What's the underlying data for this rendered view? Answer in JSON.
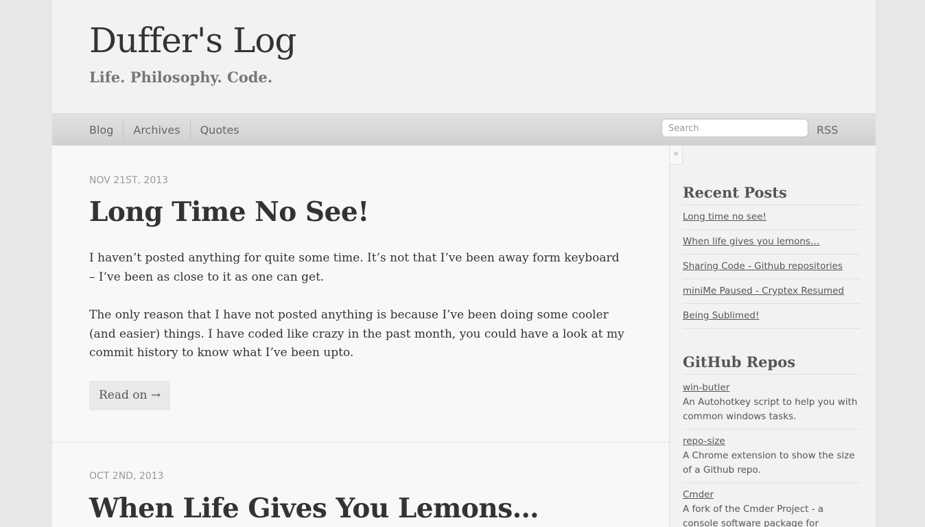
{
  "site": {
    "title": "Duffer's Log",
    "tagline": "Life. Philosophy. Code."
  },
  "nav": {
    "items": [
      "Blog",
      "Archives",
      "Quotes"
    ],
    "search_placeholder": "Search",
    "rss_label": "RSS"
  },
  "sidebar": {
    "toggle_glyph": "»",
    "recent_heading": "Recent Posts",
    "recent_posts": [
      "Long time no see!",
      "When life gives you lemons…",
      "Sharing Code - Github repositories",
      "miniMe Paused - Cryptex Resumed",
      "Being Sublimed!"
    ],
    "repos_heading": "GitHub Repos",
    "repos": [
      {
        "name": "win-butler",
        "desc": "An Autohotkey script to help you with common windows tasks."
      },
      {
        "name": "repo-size",
        "desc": "A Chrome extension to show the size of a Github repo."
      },
      {
        "name": "Cmder",
        "desc": "A fork of the Cmder Project - a console software package for windows."
      }
    ]
  },
  "posts": [
    {
      "date": "NOV 21ST, 2013",
      "title": "Long Time No See!",
      "paragraphs": [
        "I haven’t posted anything for quite some time. It’s not that I’ve been away form keyboard – I’ve been as close to it as one can get.",
        "The only reason that I have not posted anything is because I’ve been doing some cooler (and easier) things. I have coded like crazy in the past month, you could have a look at my commit history to know what I’ve been upto."
      ],
      "read_more": "Read on →"
    },
    {
      "date": "OCT 2ND, 2013",
      "title": "When Life Gives You Lemons…"
    }
  ]
}
